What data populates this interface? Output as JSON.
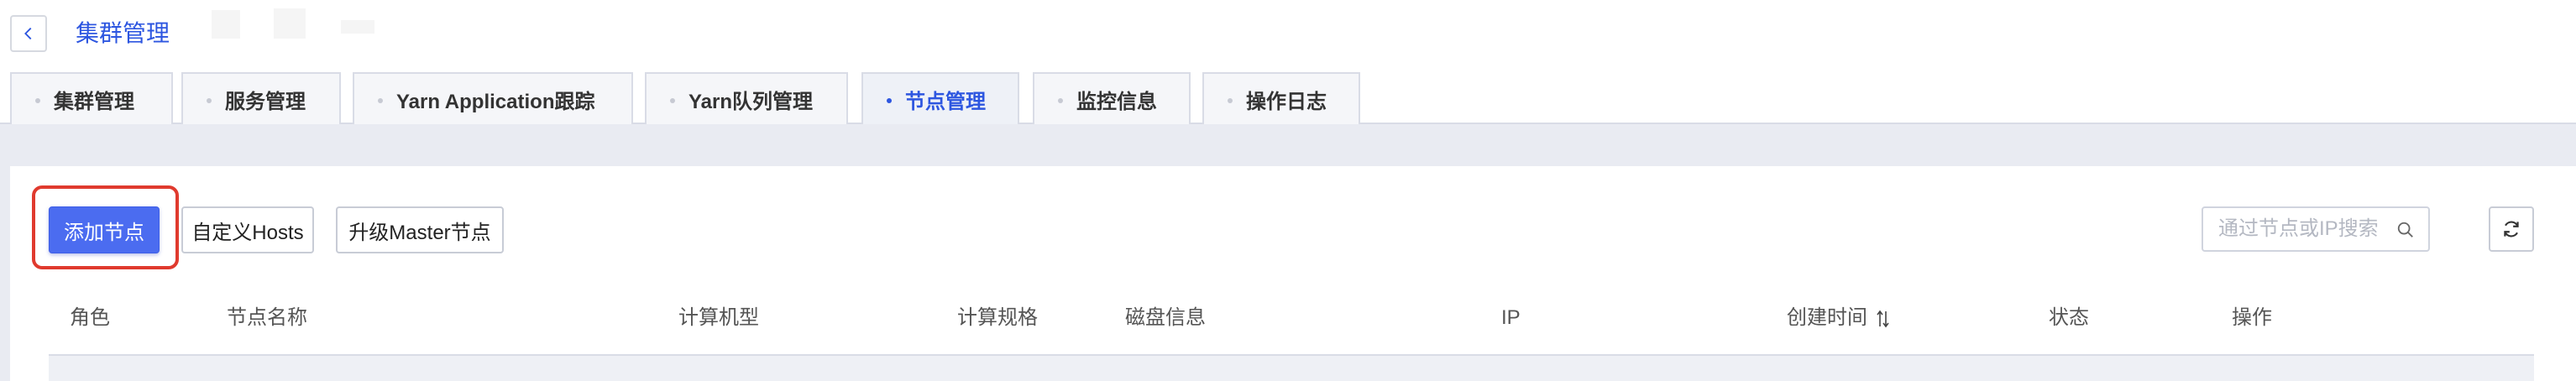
{
  "header": {
    "title": "集群管理"
  },
  "tabs": [
    {
      "label": "集群管理",
      "active": false
    },
    {
      "label": "服务管理",
      "active": false
    },
    {
      "label": "Yarn Application跟踪",
      "active": false
    },
    {
      "label": "Yarn队列管理",
      "active": false
    },
    {
      "label": "节点管理",
      "active": true
    },
    {
      "label": "监控信息",
      "active": false
    },
    {
      "label": "操作日志",
      "active": false
    }
  ],
  "toolbar": {
    "add_node_label": "添加节点",
    "custom_hosts_label": "自定义Hosts",
    "upgrade_master_label": "升级Master节点",
    "search_placeholder": "通过节点或IP搜索"
  },
  "table": {
    "columns": [
      "角色",
      "节点名称",
      "计算机型",
      "计算规格",
      "磁盘信息",
      "IP",
      "创建时间",
      "状态",
      "操作"
    ]
  },
  "colors": {
    "accent": "#2d56e0",
    "primary_button": "#4b6cf0",
    "highlight": "#e03a2e"
  }
}
